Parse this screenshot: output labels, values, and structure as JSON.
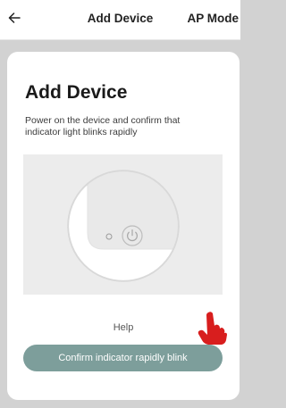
{
  "header": {
    "back_icon": "arrow-left-icon",
    "title": "Add Device",
    "mode_label": "AP Mode"
  },
  "sheet": {
    "heading": "Add Device",
    "instructions": "Power on the device and confirm that indicator light blinks rapidly",
    "illustration_icon": "power-icon",
    "help_label": "Help",
    "confirm_label": "Confirm indicator rapidly blink",
    "pointer_icon": "pointing-hand-icon"
  },
  "colors": {
    "backdrop": "#d2d2d2",
    "confirm_button": "#7d9e9b",
    "pointer_hand": "#d81e1e",
    "illustration_bg": "#ececec"
  }
}
